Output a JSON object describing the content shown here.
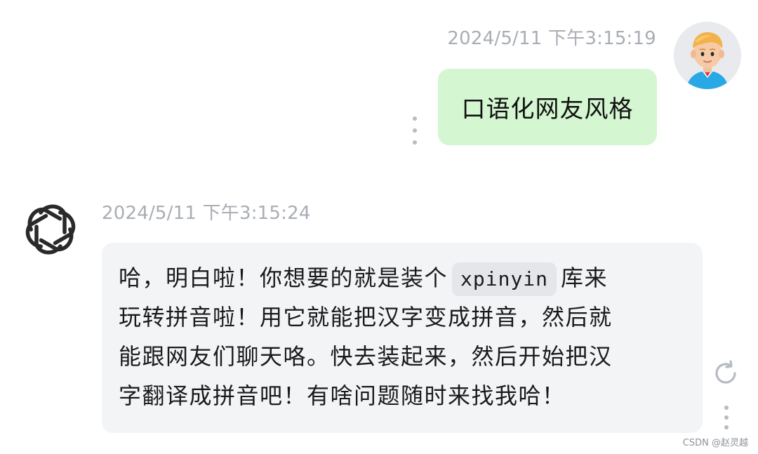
{
  "user_message": {
    "timestamp": "2024/5/11 下午3:15:19",
    "text": "口语化网友风格",
    "bubble_color": "#d4f7d1"
  },
  "ai_message": {
    "timestamp": "2024/5/11 下午3:15:24",
    "lines": [
      {
        "before": "哈，明白啦！你想要的就是装个",
        "code": "xpinyin",
        "after": "库来"
      },
      {
        "text": "玩转拼音啦！用它就能把汉字变成拼音，然后就"
      },
      {
        "text": "能跟网友们聊天咯。快去装起来，然后开始把汉"
      },
      {
        "text": "字翻译成拼音吧！有啥问题随时来找我哈！"
      }
    ],
    "bubble_color": "#f3f4f6"
  },
  "icons": {
    "user_avatar": "user-avatar-icon",
    "ai_avatar": "openai-logo-icon",
    "more": "more-vertical-icon",
    "regenerate": "regenerate-icon"
  },
  "watermark": "CSDN @赵灵越"
}
